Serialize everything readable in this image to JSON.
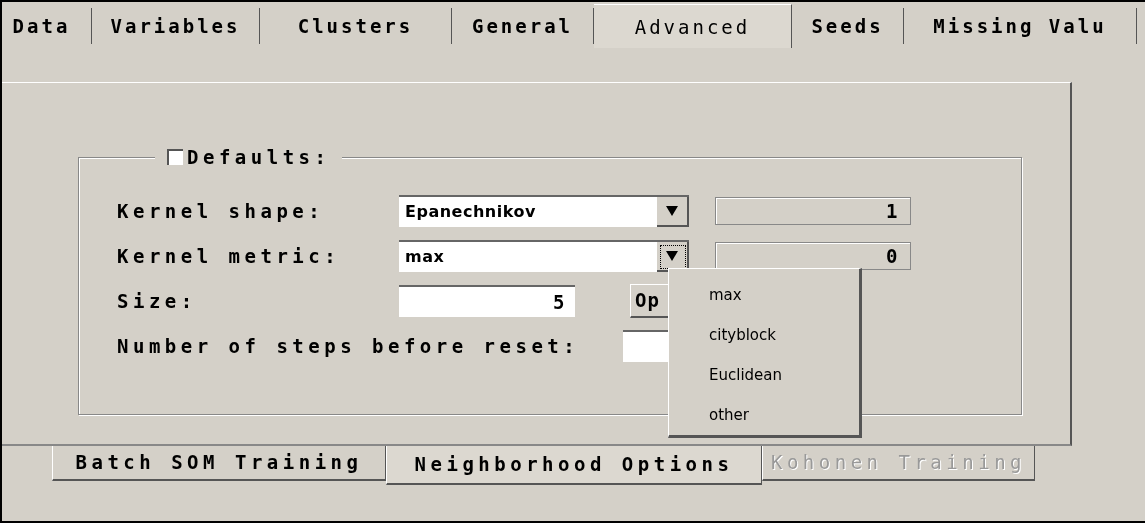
{
  "tabs": [
    {
      "label": "Data",
      "selected": false
    },
    {
      "label": "Variables",
      "selected": false
    },
    {
      "label": "Clusters",
      "selected": false
    },
    {
      "label": "General",
      "selected": false
    },
    {
      "label": "Advanced",
      "selected": true
    },
    {
      "label": "Seeds",
      "selected": false
    },
    {
      "label": "Missing Valu",
      "selected": false
    }
  ],
  "defaults": {
    "label": "Defaults:",
    "checked": false
  },
  "rows": [
    {
      "kind": "combo",
      "label": "Kernel shape:",
      "value": "Epanechnikov",
      "readout": "1",
      "focused": false
    },
    {
      "kind": "combo",
      "label": "Kernel metric:",
      "value": "max",
      "readout": "0",
      "focused": true
    },
    {
      "kind": "input",
      "label": "Size:",
      "value": "5",
      "button": "Op"
    },
    {
      "kind": "input",
      "label": "Number of steps before reset:",
      "value": ""
    }
  ],
  "dropdown": {
    "items": [
      "max",
      "cityblock",
      "Euclidean",
      "other"
    ]
  },
  "subtabs": [
    {
      "label": "Batch SOM Training",
      "selected": false,
      "disabled": false
    },
    {
      "label": "Neighborhood Options",
      "selected": true,
      "disabled": false
    },
    {
      "label": "Kohonen Training",
      "selected": false,
      "disabled": true
    }
  ]
}
